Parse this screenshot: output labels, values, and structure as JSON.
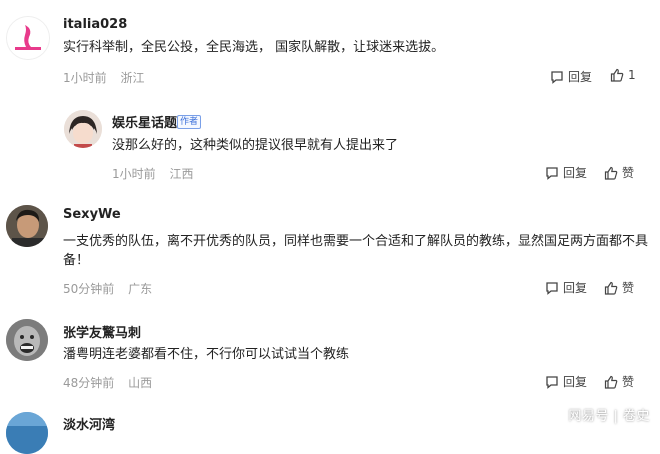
{
  "comments": [
    {
      "username": "italia028",
      "content": "实行科举制，全民公投，全民海选， 国家队解散，让球迷来选拔。",
      "time": "1小时前",
      "location": "浙江",
      "reply_label": "回复",
      "like_label": "1"
    },
    {
      "username": "娱乐星话题",
      "author_badge": "作者",
      "content": "没那么好的，这种类似的提议很早就有人提出来了",
      "time": "1小时前",
      "location": "江西",
      "reply_label": "回复",
      "like_label": "赞"
    },
    {
      "username": "SexyWe",
      "content_line1": "一支优秀的队伍，离不开优秀的队员，同样也需要一个合适和了解队员的教练，显然国足两方面都不具",
      "content_line2": "备！",
      "time": "50分钟前",
      "location": "广东",
      "reply_label": "回复",
      "like_label": "赞"
    },
    {
      "username": "张学友驚马刺",
      "content": "潘粤明连老婆都看不住，不行你可以试试当个教练",
      "time": "48分钟前",
      "location": "山西",
      "reply_label": "回复",
      "like_label": "赞"
    },
    {
      "username": "淡水河湾"
    }
  ],
  "watermark": "网易号 | 卷史",
  "icons": {
    "reply": "comment-bubble-icon",
    "like": "thumbs-up-icon"
  }
}
